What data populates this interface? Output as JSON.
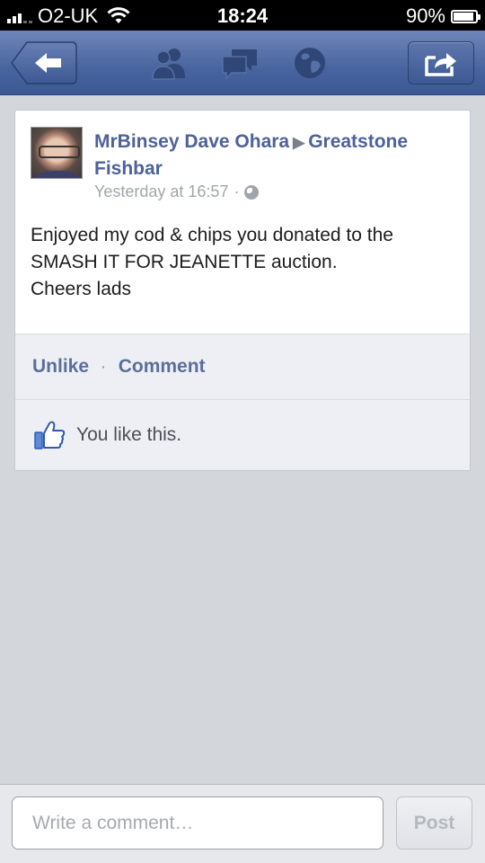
{
  "status_bar": {
    "carrier": "O2-UK",
    "time": "18:24",
    "battery": "90%",
    "battery_level": 0.9
  },
  "nav": {
    "icons": [
      "back-arrow-icon",
      "friends-icon",
      "messages-icon",
      "globe-icon",
      "share-icon"
    ]
  },
  "post": {
    "author": "MrBinsey Dave Ohara",
    "target": "Greatstone Fishbar",
    "timestamp": "Yesterday at 16:57",
    "separator": "·",
    "lines": [
      "Enjoyed my cod & chips you donated to the",
      "SMASH IT FOR JEANETTE auction.",
      "Cheers lads"
    ],
    "actions": {
      "unlike": "Unlike",
      "dot": "·",
      "comment": "Comment"
    },
    "likes_text": "You like this."
  },
  "composer": {
    "placeholder": "Write a comment…",
    "post_label": "Post"
  },
  "colors": {
    "nav_blue": "#48649f",
    "link_blue": "#4e629a",
    "action_blue": "#5b6e9b"
  }
}
